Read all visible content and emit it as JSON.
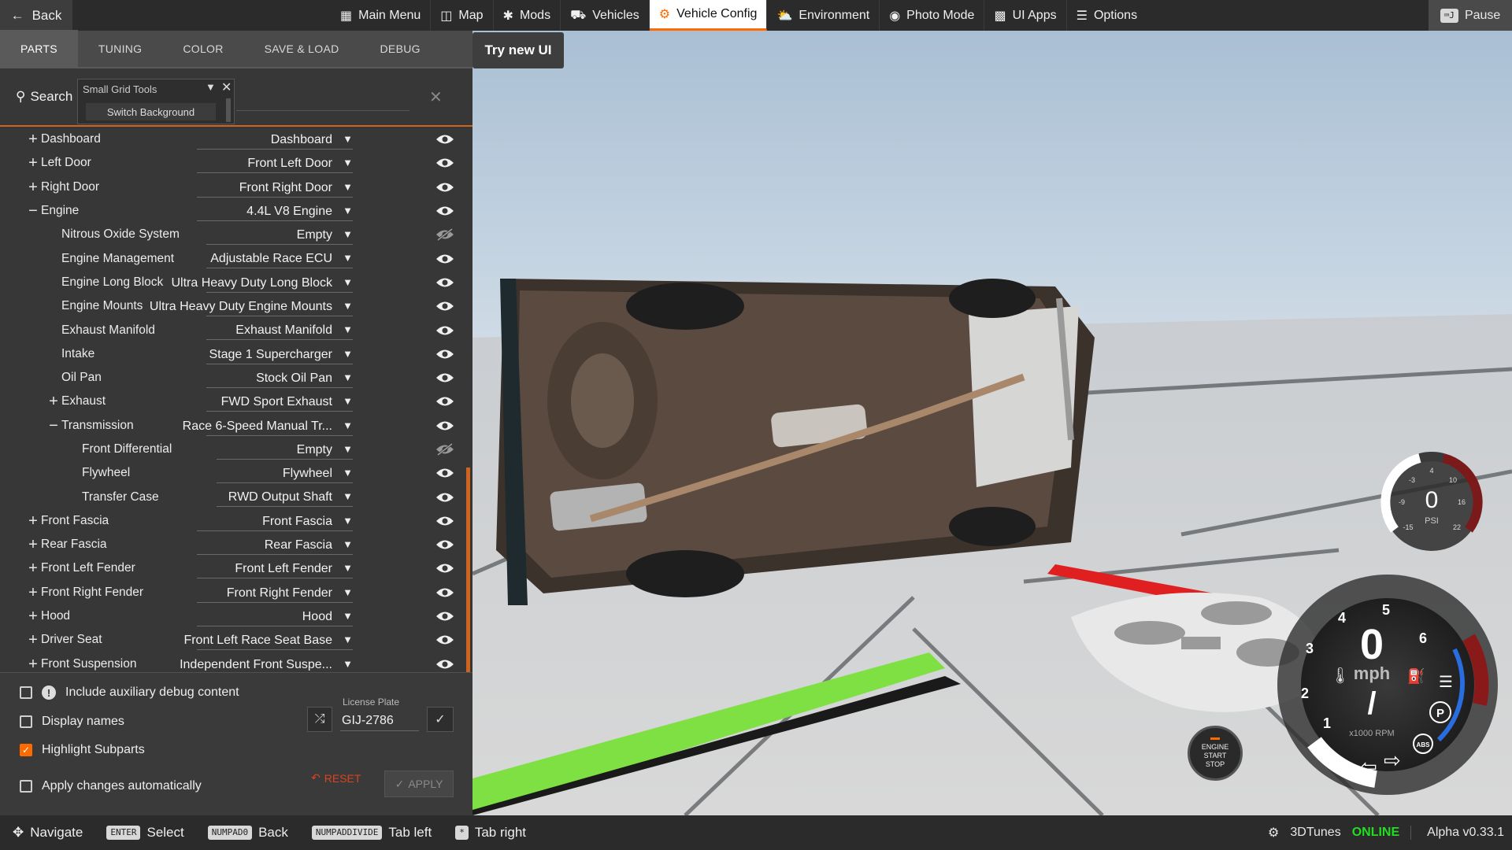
{
  "topbar": {
    "back_label": "Back",
    "menu": [
      {
        "label": "Main Menu",
        "icon": "main-menu-icon",
        "active": false
      },
      {
        "label": "Map",
        "icon": "map-icon",
        "active": false
      },
      {
        "label": "Mods",
        "icon": "mods-icon",
        "active": false
      },
      {
        "label": "Vehicles",
        "icon": "vehicles-icon",
        "active": false
      },
      {
        "label": "Vehicle Config",
        "icon": "vehicle-config-icon",
        "active": true
      },
      {
        "label": "Environment",
        "icon": "environment-icon",
        "active": false
      },
      {
        "label": "Photo Mode",
        "icon": "camera-icon",
        "active": false
      },
      {
        "label": "UI Apps",
        "icon": "ui-apps-icon",
        "active": false
      },
      {
        "label": "Options",
        "icon": "options-icon",
        "active": false
      }
    ],
    "pause_label": "Pause"
  },
  "subtabs": [
    {
      "label": "PARTS",
      "active": true
    },
    {
      "label": "TUNING",
      "active": false
    },
    {
      "label": "COLOR",
      "active": false
    },
    {
      "label": "SAVE & LOAD",
      "active": false
    },
    {
      "label": "DEBUG",
      "active": false
    }
  ],
  "try_new_ui": "Try new UI",
  "search": {
    "label": "Search",
    "value": ""
  },
  "grid_tools": {
    "title": "Small Grid Tools",
    "switch_label": "Switch Background"
  },
  "parts": [
    {
      "depth": 0,
      "expander": "+",
      "name": "Dashboard",
      "value": "Dashboard",
      "visible": true
    },
    {
      "depth": 0,
      "expander": "+",
      "name": "Left Door",
      "value": "Front Left Door",
      "visible": true
    },
    {
      "depth": 0,
      "expander": "+",
      "name": "Right Door",
      "value": "Front Right Door",
      "visible": true
    },
    {
      "depth": 0,
      "expander": "−",
      "name": "Engine",
      "value": "4.4L V8 Engine",
      "visible": true
    },
    {
      "depth": 1,
      "expander": "",
      "name": "Nitrous Oxide System",
      "value": "Empty",
      "visible": false
    },
    {
      "depth": 1,
      "expander": "",
      "name": "Engine Management",
      "value": "Adjustable Race ECU",
      "visible": true
    },
    {
      "depth": 1,
      "expander": "",
      "name": "Engine Long Block",
      "value": "Ultra Heavy Duty Long Block",
      "visible": true
    },
    {
      "depth": 1,
      "expander": "",
      "name": "Engine Mounts",
      "value": "Ultra Heavy Duty Engine Mounts",
      "visible": true
    },
    {
      "depth": 1,
      "expander": "",
      "name": "Exhaust Manifold",
      "value": "Exhaust Manifold",
      "visible": true
    },
    {
      "depth": 1,
      "expander": "",
      "name": "Intake",
      "value": "Stage 1 Supercharger",
      "visible": true
    },
    {
      "depth": 1,
      "expander": "",
      "name": "Oil Pan",
      "value": "Stock Oil Pan",
      "visible": true
    },
    {
      "depth": 1,
      "expander": "+",
      "name": "Exhaust",
      "value": "FWD Sport Exhaust",
      "visible": true
    },
    {
      "depth": 1,
      "expander": "−",
      "name": "Transmission",
      "value": "Race 6-Speed Manual Tr...",
      "visible": true
    },
    {
      "depth": 2,
      "expander": "",
      "name": "Front Differential",
      "value": "Empty",
      "visible": false
    },
    {
      "depth": 2,
      "expander": "",
      "name": "Flywheel",
      "value": "Flywheel",
      "visible": true
    },
    {
      "depth": 2,
      "expander": "",
      "name": "Transfer Case",
      "value": "RWD Output Shaft",
      "visible": true
    },
    {
      "depth": 0,
      "expander": "+",
      "name": "Front Fascia",
      "value": "Front Fascia",
      "visible": true
    },
    {
      "depth": 0,
      "expander": "+",
      "name": "Rear Fascia",
      "value": "Rear Fascia",
      "visible": true
    },
    {
      "depth": 0,
      "expander": "+",
      "name": "Front Left Fender",
      "value": "Front Left Fender",
      "visible": true
    },
    {
      "depth": 0,
      "expander": "+",
      "name": "Front Right Fender",
      "value": "Front Right Fender",
      "visible": true
    },
    {
      "depth": 0,
      "expander": "+",
      "name": "Hood",
      "value": "Hood",
      "visible": true
    },
    {
      "depth": 0,
      "expander": "+",
      "name": "Driver Seat",
      "value": "Front Left Race Seat Base",
      "visible": true
    },
    {
      "depth": 0,
      "expander": "+",
      "name": "Front Suspension",
      "value": "Independent Front Suspe...",
      "visible": true
    }
  ],
  "options": {
    "include_debug": {
      "label": "Include auxiliary debug content",
      "checked": false
    },
    "display_names": {
      "label": "Display names",
      "checked": false
    },
    "highlight_subparts": {
      "label": "Highlight Subparts",
      "checked": true
    },
    "apply_auto": {
      "label": "Apply changes automatically",
      "checked": false
    }
  },
  "license_plate": {
    "label": "License Plate",
    "value": "GIJ-2786"
  },
  "reset_label": "RESET",
  "apply_label": "APPLY",
  "boost_gauge": {
    "value": "0",
    "unit": "PSI",
    "ticks": [
      "-15",
      "-9",
      "-3",
      "4",
      "10",
      "16",
      "22"
    ]
  },
  "speedo": {
    "speed": "0",
    "unit": "mph",
    "gear": "/",
    "rpm_label": "x1000 RPM",
    "ticks": [
      "1",
      "2",
      "3",
      "4",
      "5",
      "6"
    ]
  },
  "engine_start": {
    "line1": "ENGINE",
    "line2": "START",
    "line3": "STOP"
  },
  "bottombar": {
    "hints": [
      {
        "key": "",
        "label": "Navigate"
      },
      {
        "key": "ENTER",
        "label": "Select"
      },
      {
        "key": "NUMPAD0",
        "label": "Back"
      },
      {
        "key": "NUMPADDIVIDE",
        "label": "Tab left"
      },
      {
        "key": "*",
        "label": "Tab right"
      }
    ],
    "account": "3DTunes",
    "status": "ONLINE",
    "version": "Alpha v0.33.1"
  },
  "colors": {
    "accent": "#ff6a00",
    "online": "#22dd22",
    "reset": "#d9431e"
  }
}
